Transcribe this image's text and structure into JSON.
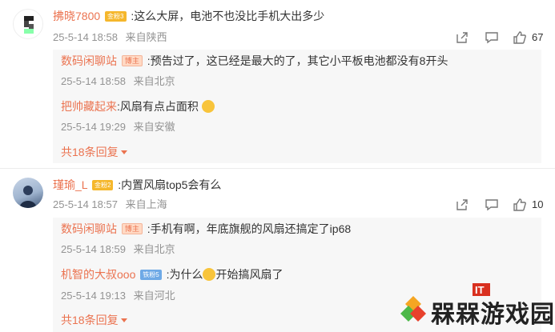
{
  "comments": [
    {
      "user": "拂晓7800",
      "badge": "金粉3",
      "text": ":这么大屏，电池不也没比手机大出多少",
      "date": "25-5-14 18:58",
      "location": "来自陕西",
      "likes": "67",
      "replies": [
        {
          "user": "数码闲聊站",
          "badge": "博主",
          "text": ":预告过了，这已经是最大的了，其它小平板电池都没有8开头",
          "date": "25-5-14 18:58",
          "location": "来自北京"
        },
        {
          "user": "把帅藏起来",
          "badge": "",
          "text": ":风扇有点占面积",
          "date": "25-5-14 19:29",
          "location": "来自安徽"
        }
      ],
      "more": "共18条回复"
    },
    {
      "user": "瑾瑜_L",
      "badge": "金粉2",
      "text": ":内置风扇top5会有么",
      "date": "25-5-14 18:57",
      "location": "来自上海",
      "likes": "10",
      "replies": [
        {
          "user": "数码闲聊站",
          "badge": "博主",
          "text": ":手机有啊，年底旗舰的风扇还搞定了ip68",
          "date": "25-5-14 18:59",
          "location": "来自北京"
        },
        {
          "user": "机智的大叔ooo",
          "badge": "铁粉5",
          "text_a": ":为什么",
          "text_b": "开始搞风扇了",
          "date": "25-5-14 19:13",
          "location": "来自河北"
        }
      ],
      "more": "共18条回复"
    }
  ],
  "watermark": {
    "text": "槑槑游戏园",
    "mark": "IT"
  },
  "colors": {
    "accent": "#eb7350",
    "meta": "#939393",
    "gold_badge": "#f5b72c",
    "iron_badge": "#6ea9e6"
  }
}
